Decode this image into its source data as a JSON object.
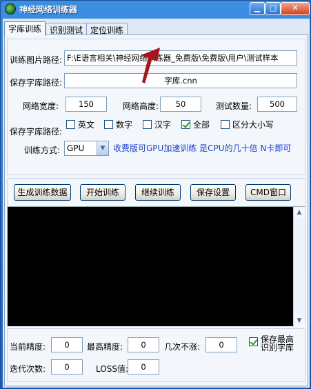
{
  "window": {
    "title": "神经网络训练器",
    "minimize": "▁",
    "maximize": "□",
    "close": "✕"
  },
  "tabs": [
    {
      "label": "字库训练",
      "active": true
    },
    {
      "label": "识别测试"
    },
    {
      "label": "定位训练"
    }
  ],
  "form": {
    "image_path_label": "训练图片路径:",
    "image_path_value": "F:\\E语言相关\\神经网络训练器_免费版\\免费版\\用户\\测试样本",
    "save_lib_label": "保存字库路径:",
    "save_lib_value": "字库.cnn",
    "net_width_label": "网络宽度:",
    "net_width_value": "150",
    "net_height_label": "网络高度:",
    "net_height_value": "50",
    "test_count_label": "测试数量:",
    "test_count_value": "500",
    "save_lib_label2": "保存字库路径:",
    "options": [
      {
        "label": "英文",
        "checked": false
      },
      {
        "label": "数字",
        "checked": false
      },
      {
        "label": "汉字",
        "checked": false
      },
      {
        "label": "全部",
        "checked": true
      },
      {
        "label": "区分大小写",
        "checked": false
      }
    ],
    "train_mode_label": "训练方式:",
    "train_mode_value": "GPU",
    "notice": "收费版可GPU加速训练 是CPU的几十倍 N卡即可"
  },
  "buttons": {
    "generate": "生成训练数据",
    "start": "开始训练",
    "continue": "继续训练",
    "save": "保存设置",
    "cmd": "CMD窗口"
  },
  "stats": {
    "current_acc_label": "当前精度:",
    "current_acc_value": "0",
    "max_acc_label": "最高精度:",
    "max_acc_value": "0",
    "stall_label": "几次不涨:",
    "stall_value": "0",
    "save_best_label": "保存最高识别字库",
    "save_best_checked": true,
    "iter_label": "迭代次数:",
    "iter_value": "0",
    "loss_label": "LOSS值:",
    "loss_value": "0"
  },
  "colors": {
    "accent_arrow": "#a3161b",
    "notice": "#1a3fc8"
  }
}
